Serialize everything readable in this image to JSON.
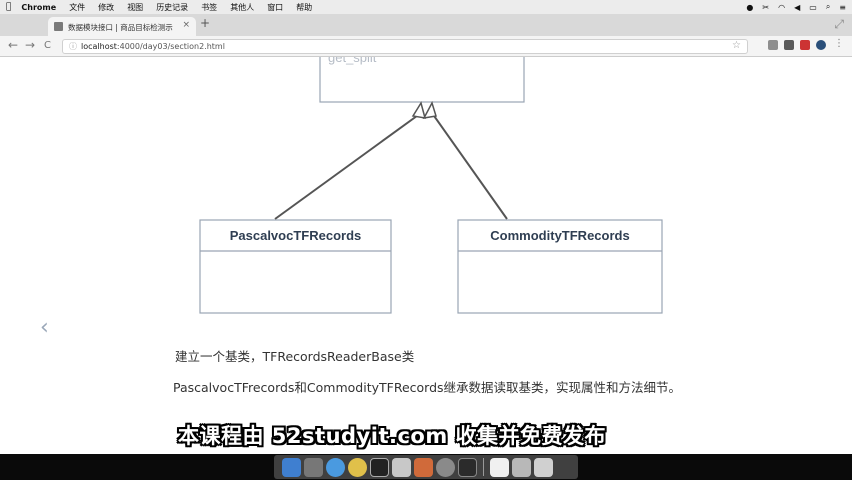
{
  "menubar": {
    "app": "Chrome",
    "items": [
      "文件",
      "修改",
      "视图",
      "历史记录",
      "书签",
      "其他人",
      "窗口",
      "帮助"
    ]
  },
  "browser": {
    "tab_title": "数据模块接口 | 商品目标检测示",
    "tab_close": "×",
    "new_tab": "+",
    "url_host": "localhost",
    "url_path": ":4000/day03/section2.html",
    "back_glyph": "←",
    "forward_glyph": "→",
    "reload_glyph": "C",
    "star_glyph": "☆"
  },
  "diagram": {
    "base_method": "get_split",
    "child_left": "PascalvocTFRecords",
    "child_right": "CommodityTFRecords",
    "colors": {
      "box_border": "#9aa5b3",
      "arrow": "#555555",
      "title_text": "#2f3e52"
    }
  },
  "content": {
    "slide_prev": "‹",
    "line1": "建立一个基类，TFRecordsReaderBase类",
    "line2": "PascalvocTFrecords和CommodityTFRecords继承数据读取基类，实现属性和方法细节。"
  },
  "overlay": {
    "subtitle": "本课程由 52studyit.com 收集并免费发布"
  },
  "dock": {
    "icon_names": [
      "finder-icon",
      "launchpad-icon",
      "safari-icon",
      "chrome-icon",
      "pycharm-icon",
      "preview-icon",
      "keynote-icon",
      "system-preferences-icon",
      "terminal-icon",
      "textedit-icon",
      "trash-icon"
    ]
  }
}
